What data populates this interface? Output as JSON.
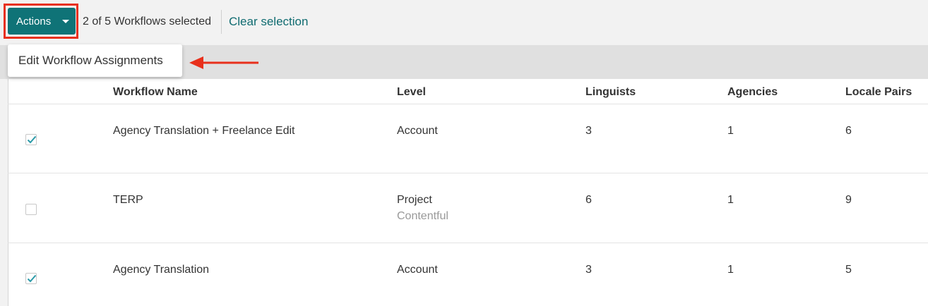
{
  "toolbar": {
    "actions_label": "Actions",
    "selection_status": "2 of 5 Workflows selected",
    "clear_selection_label": "Clear selection"
  },
  "dropdown": {
    "items": [
      {
        "label": "Edit Workflow Assignments"
      }
    ]
  },
  "table": {
    "columns": [
      "Workflow Name",
      "Level",
      "Linguists",
      "Agencies",
      "Locale Pairs"
    ],
    "rows": [
      {
        "checked": true,
        "name": "Agency Translation + Freelance Edit",
        "level": "Account",
        "level_sub": "",
        "linguists": "3",
        "agencies": "1",
        "locale_pairs": "6"
      },
      {
        "checked": false,
        "name": "TERP",
        "level": "Project",
        "level_sub": "Contentful",
        "linguists": "6",
        "agencies": "1",
        "locale_pairs": "9"
      },
      {
        "checked": true,
        "name": "Agency Translation",
        "level": "Account",
        "level_sub": "",
        "linguists": "3",
        "agencies": "1",
        "locale_pairs": "5"
      }
    ]
  },
  "colors": {
    "accent": "#0f7377",
    "highlight": "#e8301c",
    "check": "#2a9aa8"
  }
}
